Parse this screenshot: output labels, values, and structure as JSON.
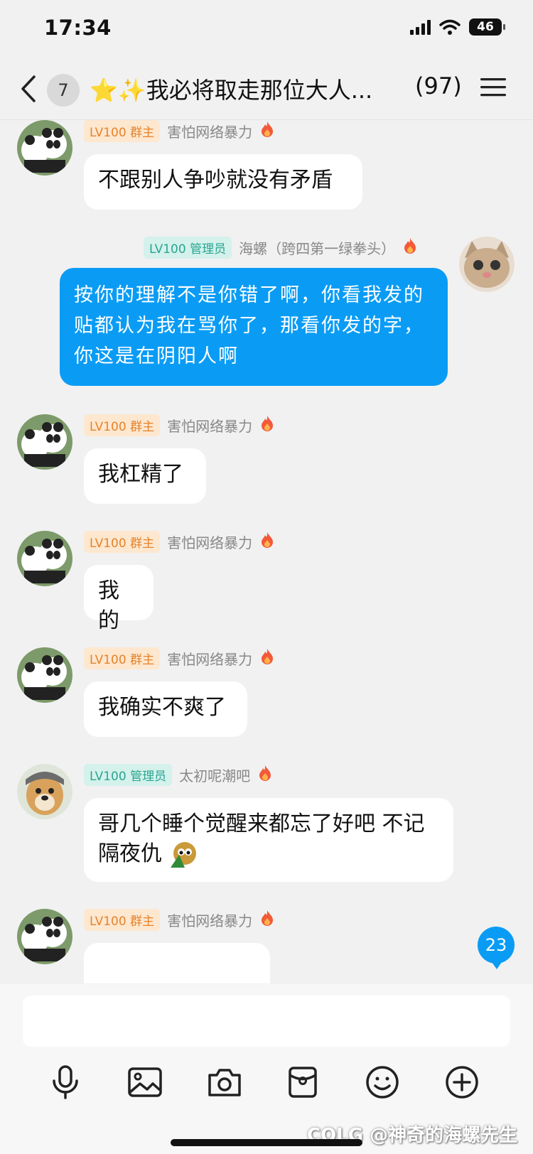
{
  "status_bar": {
    "time": "17:34",
    "battery": "46"
  },
  "nav": {
    "unread": "7",
    "title": "⭐✨我必将取走那位大人...",
    "member_count": "(97)"
  },
  "messages": [
    {
      "sender": "害怕网络暴力",
      "level": "LV100",
      "role": "群主",
      "text": "不跟别人争吵就没有矛盾"
    },
    {
      "sender": "海螺（跨四第一绿拳头）",
      "level": "LV100",
      "role": "管理员",
      "text": "按你的理解不是你错了啊，你看我发的贴都认为我在骂你了，那看你发的字，你这是在阴阳人啊"
    },
    {
      "sender": "害怕网络暴力",
      "level": "LV100",
      "role": "群主",
      "text": "我杠精了"
    },
    {
      "sender": "害怕网络暴力",
      "level": "LV100",
      "role": "群主",
      "text": "我的"
    },
    {
      "sender": "害怕网络暴力",
      "level": "LV100",
      "role": "群主",
      "text": "我确实不爽了"
    },
    {
      "sender": "太初呢潮吧",
      "level": "LV100",
      "role": "管理员",
      "text": "哥几个睡个觉醒来都忘了好吧 不记隔夜仇"
    },
    {
      "sender": "害怕网络暴力",
      "level": "LV100",
      "role": "群主",
      "text": ""
    }
  ],
  "unread_float": "23",
  "watermark": "COLG @神奇的海螺先生",
  "icons": [
    "back-icon",
    "menu-icon",
    "fire-icon",
    "microphone-icon",
    "image-icon",
    "camera-icon",
    "red-packet-icon",
    "emoji-icon",
    "plus-icon"
  ],
  "colors": {
    "accent": "#0a9cf5",
    "owner_badge": "#e6832a",
    "admin_badge": "#2aa58f"
  }
}
